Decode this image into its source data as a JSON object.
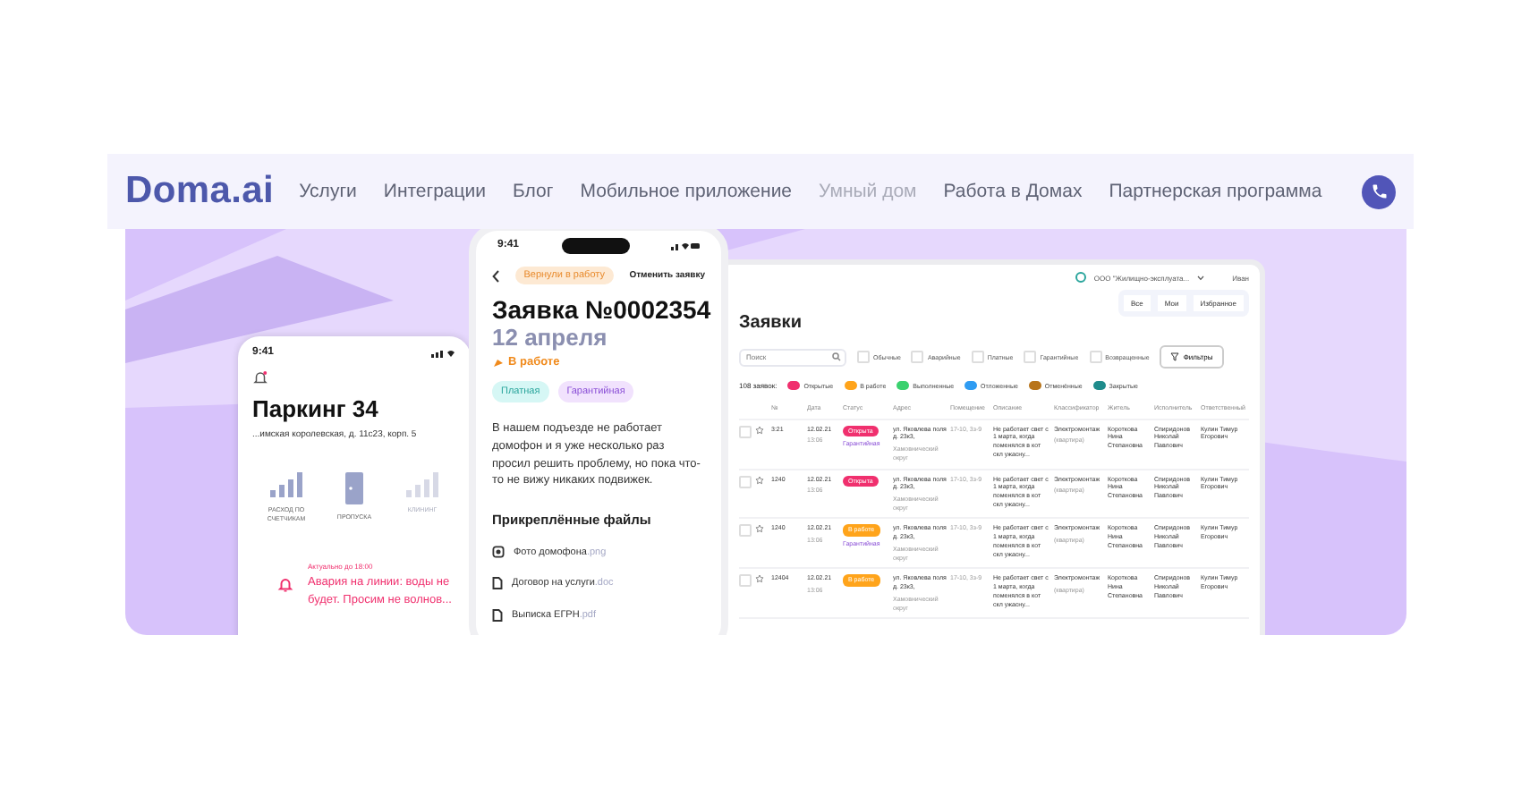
{
  "nav": {
    "logo": "Doma.ai",
    "items": [
      {
        "label": "Услуги",
        "disabled": false
      },
      {
        "label": "Интеграции",
        "disabled": false
      },
      {
        "label": "Блог",
        "disabled": false
      },
      {
        "label": "Мобильное приложение",
        "disabled": false
      },
      {
        "label": "Умный дом",
        "disabled": true
      },
      {
        "label": "Работа в Домах",
        "disabled": false
      },
      {
        "label": "Партнерская программа",
        "disabled": false
      }
    ]
  },
  "parking_phone": {
    "time": "9:41",
    "title": "Паркинг 34",
    "address": "...имская королевская, д. 11с23, корп. 5",
    "tiles": [
      {
        "label": "РАСХОД ПО СЧЕТЧИКАМ",
        "kind": "meter",
        "disabled": false
      },
      {
        "label": "ПРОПУСКА",
        "kind": "door",
        "disabled": false
      },
      {
        "label": "КЛИНИНГ",
        "kind": "meter",
        "disabled": true
      }
    ],
    "alert": {
      "note": "Актуально до 18:00",
      "text": "Авария на линии: воды не будет. Просим не волнов..."
    }
  },
  "request_phone": {
    "time": "9:41",
    "badge": "Вернули в работу",
    "cancel": "Отменить заявку",
    "title": "Заявка №0002354",
    "date": "12 апреля",
    "state": "В работе",
    "tags": [
      {
        "label": "Платная",
        "color": "#d6f7f5"
      },
      {
        "label": "Гарантийная",
        "color": "#f1e2fd"
      }
    ],
    "description": "В нашем подъезде не работает домофон и я уже несколько раз просил решить проблему, но пока что-то не вижу никаких подвижек.",
    "files_title": "Прикреплённые файлы",
    "files": [
      {
        "name": "Фото домофона",
        "ext": ".png",
        "kind": "photo"
      },
      {
        "name": "Договор на услуги",
        "ext": ".doc",
        "kind": "doc"
      },
      {
        "name": "Выписка ЕГРН",
        "ext": ".pdf",
        "kind": "doc"
      }
    ]
  },
  "desktop": {
    "org": "ООО \"Жилищно-эксплуата...",
    "user": "Иван",
    "views": [
      "Все",
      "Мои",
      "Избранное"
    ],
    "title": "Заявки",
    "search": {
      "placeholder": "Поиск"
    },
    "types": [
      {
        "label": "Обычные",
        "checked": false
      },
      {
        "label": "Аварийные",
        "checked": false
      },
      {
        "label": "Платные",
        "checked": false
      },
      {
        "label": "Гарантийные",
        "checked": false
      },
      {
        "label": "Возвращенные",
        "checked": false
      }
    ],
    "filters_button": "Фильтры",
    "count": "108 заявок:",
    "statuses": [
      {
        "label": "Открытые",
        "color": "#f0306e"
      },
      {
        "label": "В работе",
        "color": "#ffa41b"
      },
      {
        "label": "Выполненные",
        "color": "#3bd16f"
      },
      {
        "label": "Отложенные",
        "color": "#2f9cf2"
      },
      {
        "label": "Отменённые",
        "color": "#b8741a"
      },
      {
        "label": "Закрытые",
        "color": "#1f8c8c"
      }
    ],
    "columns": [
      "№",
      "Дата",
      "Статус",
      "Адрес",
      "Помещение",
      "Описание",
      "Классификатор",
      "Житель",
      "Исполнитель",
      "Ответственный"
    ],
    "rows": [
      {
        "checked": false,
        "number": "3:21",
        "date": "12.02.21",
        "time": "13:06",
        "status": {
          "label": "Открыта",
          "color": "#f0306e"
        },
        "warranty": "Гарантийная",
        "address": "ул. Яковлева поля д. 23к3,",
        "district": "Хамовнический округ",
        "room": "17-10, 3з-9",
        "description": "Не работает свет с 1 марта, когда поменялся в кот скл ужасну...",
        "classifier": "Электромонтаж",
        "classifier_note": "(квартира)",
        "resident": "Короткова Нина Степановна",
        "executor": "Спиридонов Николай Павлович",
        "responsible": "Кулин Тимур Егорович"
      },
      {
        "checked": false,
        "number": "1240",
        "date": "12.02.21",
        "time": "13:06",
        "status": {
          "label": "Открыта",
          "color": "#f0306e"
        },
        "address": "ул. Яковлева поля д. 23к3,",
        "district": "Хамовнический округ",
        "room": "17-10, 3з-9",
        "description": "Не работает свет с 1 марта, когда поменялся в кот скл ужасну...",
        "classifier": "Электромонтаж",
        "classifier_note": "(квартира)",
        "resident": "Короткова Нина Степановна",
        "executor": "Спиридонов Николай Павлович",
        "responsible": "Кулин Тимур Егорович"
      },
      {
        "checked": false,
        "number": "1240",
        "date": "12.02.21",
        "time": "13:06",
        "status": {
          "label": "В работе",
          "color": "#ffa41b"
        },
        "warranty": "Гарантийная",
        "address": "ул. Яковлева поля д. 23к3,",
        "district": "Хамовнический округ",
        "room": "17-10, 3з-9",
        "description": "Не работает свет с 1 марта, когда поменялся в кот скл ужасну...",
        "classifier": "Электромонтаж",
        "classifier_note": "(квартира)",
        "resident": "Короткова Нина Степановна",
        "executor": "Спиридонов Николай Павлович",
        "responsible": "Кулин Тимур Егорович"
      },
      {
        "checked": false,
        "number": "12404",
        "date": "12.02.21",
        "time": "13:06",
        "status": {
          "label": "В работе",
          "color": "#ffa41b"
        },
        "address": "ул. Яковлева поля д. 23к3,",
        "district": "Хамовнический округ",
        "room": "17-10, 3з-9",
        "description": "Не работает свет с 1 марта, когда поменялся в кот скл ужасну...",
        "classifier": "Электромонтаж",
        "classifier_note": "(квартира)",
        "resident": "Короткова Нина Степановна",
        "executor": "Спиридонов Николай Павлович",
        "responsible": "Кулин Тимур Егорович"
      }
    ]
  }
}
